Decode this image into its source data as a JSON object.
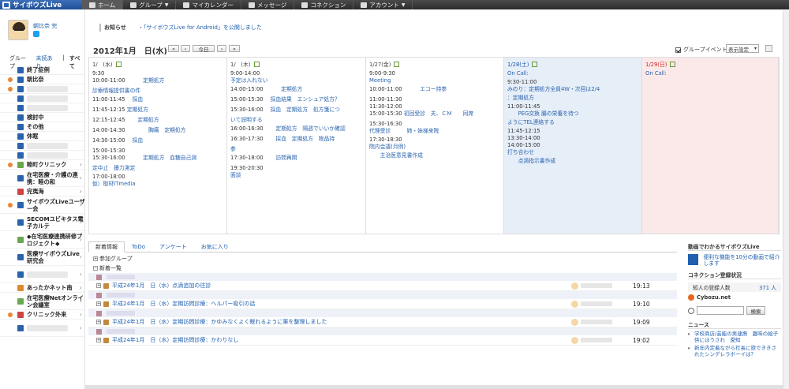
{
  "app": {
    "logo": "サイボウズLive"
  },
  "nav": [
    {
      "label": "ホーム",
      "icon": "home-icon",
      "active": true
    },
    {
      "label": "グループ",
      "icon": "group-icon",
      "dropdown": true
    },
    {
      "label": "マイカレンダー",
      "icon": "calendar-icon"
    },
    {
      "label": "メッセージ",
      "icon": "message-icon"
    },
    {
      "label": "コネクション",
      "icon": "connection-icon"
    },
    {
      "label": "アカウント",
      "icon": "account-icon",
      "dropdown": true
    }
  ],
  "profile": {
    "name": "朝比奈 完"
  },
  "groups_header": {
    "title": "グループ",
    "unread": "未読あり",
    "sep": "|",
    "all": "すべて"
  },
  "groups": [
    {
      "label": "終了症例",
      "icon": "b",
      "dot": false
    },
    {
      "label": "朝比奈",
      "icon": "b",
      "dot": true
    },
    {
      "label": "",
      "icon": "b",
      "dot": true
    },
    {
      "label": "",
      "icon": "b",
      "dot": false
    },
    {
      "label": "",
      "icon": "b",
      "dot": false
    },
    {
      "label": "検討中",
      "icon": "b",
      "dot": false
    },
    {
      "label": "その他",
      "icon": "b",
      "dot": false
    },
    {
      "label": "休眠",
      "icon": "b",
      "dot": false
    },
    {
      "label": "",
      "icon": "b",
      "dot": false
    },
    {
      "label": "",
      "icon": "b",
      "dot": false
    }
  ],
  "groups2": [
    {
      "label": "睦町クリニック",
      "icon": "g",
      "dot": true,
      "arrow": true
    },
    {
      "label": "在宅医療・介護の連携：睦の和",
      "icon": "b",
      "dot": false,
      "arrow": true
    },
    {
      "label": "完夷海",
      "icon": "r",
      "dot": false,
      "arrow": true
    },
    {
      "label": "サイボウズLiveユーザー会",
      "icon": "b",
      "dot": true,
      "arrow": true
    },
    {
      "label": "SECOMユビキタス電子カルテ",
      "icon": "b",
      "dot": false,
      "arrow": true
    },
    {
      "label": "◆在宅医療連携研修プロジェクト◆",
      "icon": "g",
      "dot": false,
      "arrow": true
    },
    {
      "label": "医療サイボウズLive研究会",
      "icon": "b",
      "dot": false,
      "arrow": true
    },
    {
      "label": "",
      "icon": "b",
      "dot": false,
      "arrow": true
    },
    {
      "label": "あったかネット南",
      "icon": "o",
      "dot": false,
      "arrow": true
    },
    {
      "label": "在宅医療Netオンライン会議室",
      "icon": "g",
      "dot": false,
      "arrow": true
    },
    {
      "label": "クリニック外来",
      "icon": "r",
      "dot": true,
      "arrow": true
    },
    {
      "label": "",
      "icon": "b",
      "dot": false,
      "arrow": true
    }
  ],
  "notice": {
    "label": "お知らせ",
    "text": "・「サイボウズLive for Android」を公開しました"
  },
  "calendar": {
    "date": "2012年1月　日(水)",
    "today": "今日",
    "group_event": "グループイベント",
    "display_setting": "表示設定"
  },
  "days": [
    {
      "head": "1/　(水)",
      "type": "wd",
      "events": [
        {
          "t": "9:30",
          "s": ""
        },
        {
          "t": "10:00-11:00",
          "s": "　　　定期処方"
        },
        {
          "t": "",
          "s": "診療情報提供書の件"
        },
        {
          "t": "11:00-11:45",
          "s": "　採血"
        },
        {
          "t": "11:45-12:15",
          "s": "定期処方"
        },
        {
          "t": "12:15-12:45",
          "s": "　　定期処方"
        },
        {
          "t": "14:00-14:30",
          "s": "　　　　胸痛　定期処方"
        },
        {
          "t": "14:30-15:00",
          "s": "　採血"
        },
        {
          "t": "15:00-15:30",
          "s": ""
        },
        {
          "t": "15:30-16:00",
          "s": "　　　定期処方　血糖自己測"
        },
        {
          "t": "",
          "s": "定中止　擾力測定"
        },
        {
          "t": "17:00-18:00",
          "s": ""
        },
        {
          "t": "",
          "s": "仮）取材ITmedia"
        }
      ]
    },
    {
      "head": "1/　(木)",
      "type": "wd",
      "events": [
        {
          "t": "9:00-14:00",
          "s": ""
        },
        {
          "t": "",
          "s": "予定は入れない"
        },
        {
          "t": "14:00-15:00",
          "s": "　　　定期処方"
        },
        {
          "t": "15:00-15:30",
          "s": "　採血結果　エンシュア処方？"
        },
        {
          "t": "15:30-16:00",
          "s": "　採血　定期処方　処方箋につ"
        },
        {
          "t": "",
          "s": "いて説明する"
        },
        {
          "t": "16:00-16:30",
          "s": "　　定期処方　隔週でいいか確認"
        },
        {
          "t": "16:30-17:30",
          "s": "　　採血　定期処方　物品持"
        },
        {
          "t": "",
          "s": "参"
        },
        {
          "t": "17:30-18:00",
          "s": "　　訪問再開"
        },
        {
          "t": "19:30-20:30",
          "s": ""
        },
        {
          "t": "",
          "s": "面談"
        }
      ]
    },
    {
      "head": "1/27(金)",
      "type": "wd",
      "events": [
        {
          "t": "9:00-9:30",
          "s": ""
        },
        {
          "t": "",
          "s": "Meeting"
        },
        {
          "t": "10:00-11:00",
          "s": "　　　エコー持参"
        },
        {
          "t": "11:00-11:30",
          "s": ""
        },
        {
          "t": "11:30-12:00",
          "s": ""
        },
        {
          "t": "15:00-15:30",
          "s": "初回受診　夫、ＣＭ　　同席"
        },
        {
          "t": "15:30-16:30",
          "s": ""
        },
        {
          "t": "",
          "s": "代理受診　　　姉・妹様来院"
        },
        {
          "t": "17:30-18:30",
          "s": ""
        },
        {
          "t": "",
          "s": "院内会議(月例)"
        },
        {
          "t": "",
          "s": "　　主治医意見書作成"
        }
      ]
    },
    {
      "head": "1/28(土)",
      "type": "sat",
      "events": [
        {
          "t": "",
          "s": "On Call:"
        },
        {
          "t": "9:30-11:00",
          "s": ""
        },
        {
          "t": "",
          "s": "みのり：定期処方全員4W・次回は2/4"
        },
        {
          "t": "",
          "s": "：定期処方"
        },
        {
          "t": "11:00-11:45",
          "s": ""
        },
        {
          "t": "",
          "s": "　　PEG交換 腸の栄養を待つ"
        },
        {
          "t": "",
          "s": "ようにTEL連絡する"
        },
        {
          "t": "11:45-12:15",
          "s": ""
        },
        {
          "t": "13:30-14:00",
          "s": ""
        },
        {
          "t": "14:00-15:00",
          "s": ""
        },
        {
          "t": "",
          "s": "打ち合わせ"
        },
        {
          "t": "",
          "s": "　　点滴指示書作成"
        }
      ]
    },
    {
      "head": "1/29(日)",
      "type": "sun",
      "events": [
        {
          "t": "",
          "s": "On Call:"
        }
      ]
    }
  ],
  "tabs": [
    {
      "label": "新着情報",
      "active": true
    },
    {
      "label": "ToDo"
    },
    {
      "label": "アンケート"
    },
    {
      "label": "お気に入り"
    }
  ],
  "feed": {
    "sec1": "参加グループ",
    "sec2": "新着一覧",
    "items": [
      {
        "text": "平成24年1月　日（水）点滴追加の往診",
        "time": "19:13"
      },
      {
        "text": "平成24年1月　日（水）定期訪問診療：ヘルパー吸引の話",
        "time": "19:10"
      },
      {
        "text": "平成24年1月　日（水）定期訪問診療：かゆみなくよく眠れるように薬を整理しました",
        "time": "19:09"
      },
      {
        "text": "平成24年1月　日（水）定期訪問診療：かわりなし",
        "time": "19:02"
      }
    ]
  },
  "right": {
    "movie_title": "動画でわかるサイボウズLive",
    "movie_text": "便利な機能を10分の動画で紹介します",
    "conn_title": "コネクション登録状況",
    "conn_label": "知人の登録人数",
    "conn_value": "371 人",
    "cybozu": "Cybozu.net",
    "search_btn": "検索",
    "news_title": "ニュース",
    "news": [
      "学校商店/芸能の男連携　趣味の絵子供にほうされ　愛知",
      "新年内定着ながら社長に旅でききされたシンデレラボーイは？"
    ]
  }
}
